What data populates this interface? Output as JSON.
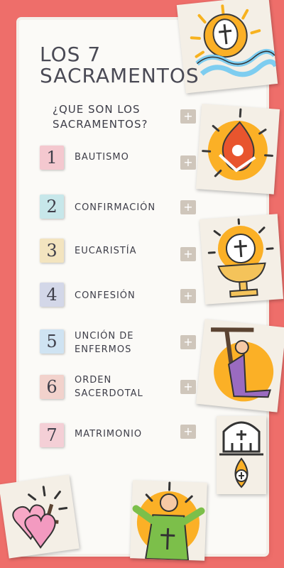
{
  "title": {
    "line1": "LOS 7",
    "line2": "SACRAMENTOS"
  },
  "intro": {
    "label": "¿QUE SON LOS SACRAMENTOS?",
    "button": "+"
  },
  "sacraments": [
    {
      "number": "1",
      "label": "BAUTISMO",
      "button": "+",
      "tile_color": "#f4c8cf"
    },
    {
      "number": "2",
      "label": "CONFIRMACIÓN",
      "button": "+",
      "tile_color": "#c7e7ea"
    },
    {
      "number": "3",
      "label": "EUCARISTÍA",
      "button": "+",
      "tile_color": "#f3e4bf"
    },
    {
      "number": "4",
      "label": "CONFESIÓN",
      "button": "+",
      "tile_color": "#d3d7e8"
    },
    {
      "number": "5",
      "label": "UNCIÓN DE ENFERMOS",
      "button": "+",
      "tile_color": "#cfe3f2"
    },
    {
      "number": "6",
      "label": "ORDEN SACERDOTAL",
      "button": "+",
      "tile_color": "#f2d2cc"
    },
    {
      "number": "7",
      "label": "MATRIMONIO",
      "button": "+",
      "tile_color": "#f4cfd6"
    }
  ],
  "colors": {
    "background": "#ee6e6a",
    "accent_yellow": "#fbb026",
    "plus_button": "#cfc6bb"
  },
  "icons": [
    "baptism-icon",
    "confirmation-icon",
    "eucharist-icon",
    "confession-icon",
    "anointing-icon",
    "priest-icon",
    "matrimony-icon"
  ]
}
